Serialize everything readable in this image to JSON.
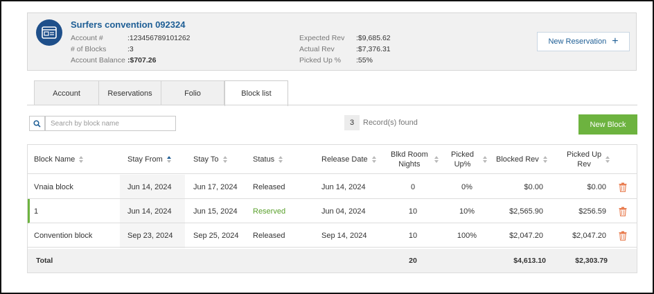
{
  "header": {
    "title": "Surfers convention 092324",
    "labels_left": [
      "Account #",
      "# of Blocks",
      "Account Balance"
    ],
    "values_left": [
      ":123456789101262",
      ":3",
      ":$707.26"
    ],
    "labels_right": [
      "Expected Rev",
      "Actual Rev",
      "Picked Up %"
    ],
    "values_right": [
      ":$9,685.62",
      ":$7,376.31",
      ":55%"
    ],
    "new_reservation_label": "New Reservation",
    "new_reservation_icon": "plus-icon"
  },
  "tabs": [
    {
      "label": "Account"
    },
    {
      "label": "Reservations"
    },
    {
      "label": "Folio"
    },
    {
      "label": "Block list",
      "active": true
    }
  ],
  "search": {
    "placeholder": "Search by block name",
    "icon": "search-icon"
  },
  "records": {
    "count": "3",
    "label": "Record(s) found"
  },
  "new_block_label": "New Block",
  "table": {
    "columns": [
      "Block Name",
      "Stay From",
      "Stay To",
      "Status",
      "Release Date",
      "Blkd Room Nights",
      "Picked Up%",
      "Blocked Rev",
      "Picked Up Rev"
    ],
    "column_lines": {
      "blkd": [
        "Blkd Room",
        "Nights"
      ],
      "picked": [
        "Picked",
        "Up%"
      ],
      "pickedrev": [
        "Picked Up",
        "Rev"
      ]
    },
    "rows": [
      {
        "name": "Vnaia block",
        "stay_from": "Jun 14, 2024",
        "stay_to": "Jun 17, 2024",
        "status": "Released",
        "release_date": "Jun 14, 2024",
        "nights": "0",
        "picked_pct": "0%",
        "blocked_rev": "$0.00",
        "picked_rev": "$0.00"
      },
      {
        "name": "1",
        "stay_from": "Jun 14, 2024",
        "stay_to": "Jun 15, 2024",
        "status": "Reserved",
        "release_date": "Jun 04, 2024",
        "nights": "10",
        "picked_pct": "10%",
        "blocked_rev": "$2,565.90",
        "picked_rev": "$256.59"
      },
      {
        "name": "Convention block",
        "stay_from": "Sep 23, 2024",
        "stay_to": "Sep 25, 2024",
        "status": "Released",
        "release_date": "Sep 14, 2024",
        "nights": "10",
        "picked_pct": "100%",
        "blocked_rev": "$2,047.20",
        "picked_rev": "$2,047.20"
      }
    ],
    "total": {
      "label": "Total",
      "nights": "20",
      "blocked_rev": "$4,613.10",
      "picked_rev": "$2,303.79"
    }
  },
  "colors": {
    "accent_blue": "#1e5e95",
    "green": "#6db33f",
    "trash": "#e8794b"
  }
}
